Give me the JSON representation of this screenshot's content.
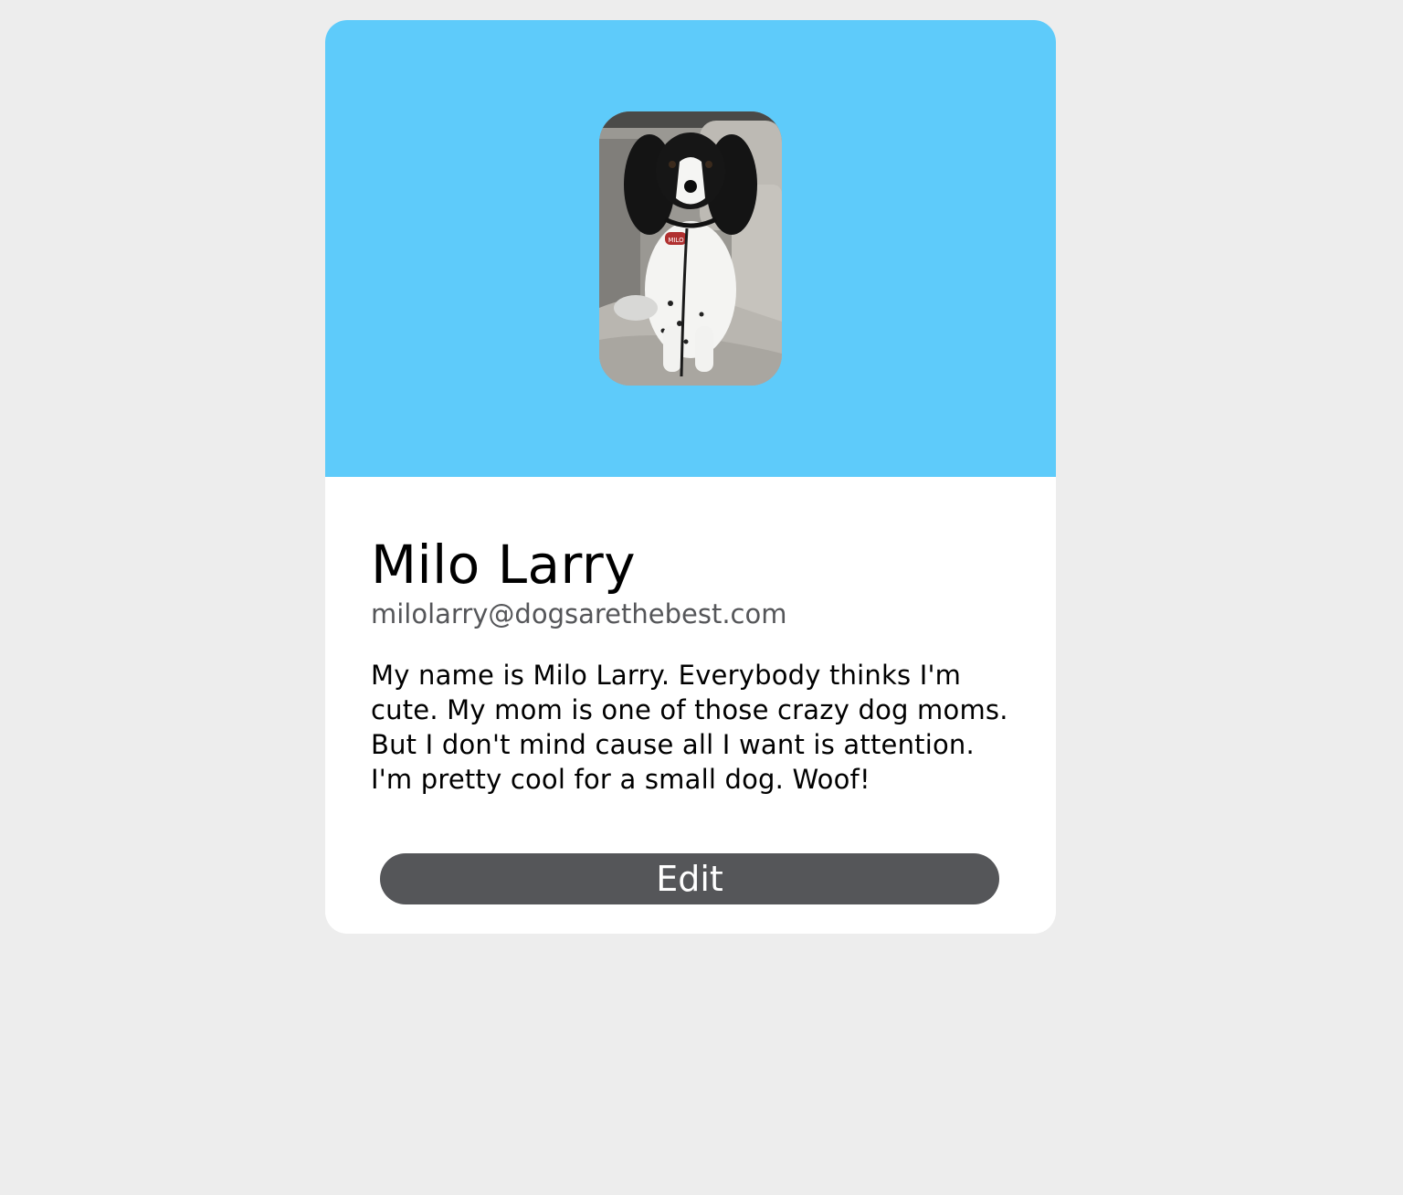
{
  "profile": {
    "photo_alt": "dog-photo",
    "name": "Milo Larry",
    "email": "milolarry@dogsarethebest.com",
    "bio": "My name is Milo Larry. Everybody thinks I'm cute. My mom is one of those crazy dog moms. But I don't mind cause all I want is attention. I'm pretty cool for a small dog. Woof!",
    "tag_text": "MILO"
  },
  "actions": {
    "edit_label": "Edit"
  },
  "colors": {
    "header": "#5ecbfa",
    "button": "#555659",
    "page_background": "#ededed",
    "card_background": "#ffffff"
  }
}
